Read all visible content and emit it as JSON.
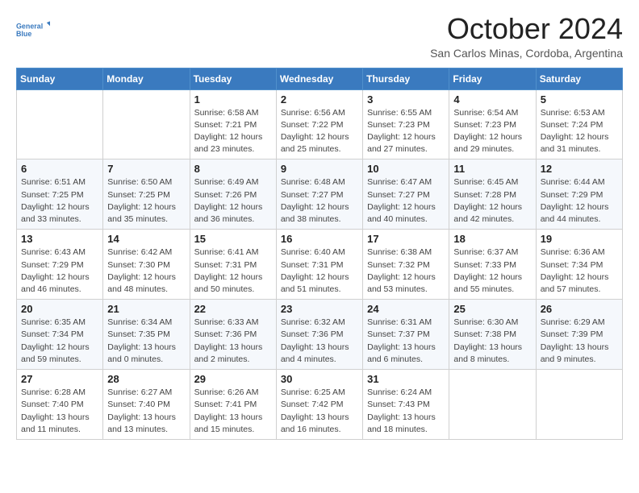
{
  "logo": {
    "line1": "General",
    "line2": "Blue"
  },
  "header": {
    "month": "October 2024",
    "location": "San Carlos Minas, Cordoba, Argentina"
  },
  "weekdays": [
    "Sunday",
    "Monday",
    "Tuesday",
    "Wednesday",
    "Thursday",
    "Friday",
    "Saturday"
  ],
  "weeks": [
    [
      {
        "day": "",
        "info": ""
      },
      {
        "day": "",
        "info": ""
      },
      {
        "day": "1",
        "info": "Sunrise: 6:58 AM\nSunset: 7:21 PM\nDaylight: 12 hours\nand 23 minutes."
      },
      {
        "day": "2",
        "info": "Sunrise: 6:56 AM\nSunset: 7:22 PM\nDaylight: 12 hours\nand 25 minutes."
      },
      {
        "day": "3",
        "info": "Sunrise: 6:55 AM\nSunset: 7:23 PM\nDaylight: 12 hours\nand 27 minutes."
      },
      {
        "day": "4",
        "info": "Sunrise: 6:54 AM\nSunset: 7:23 PM\nDaylight: 12 hours\nand 29 minutes."
      },
      {
        "day": "5",
        "info": "Sunrise: 6:53 AM\nSunset: 7:24 PM\nDaylight: 12 hours\nand 31 minutes."
      }
    ],
    [
      {
        "day": "6",
        "info": "Sunrise: 6:51 AM\nSunset: 7:25 PM\nDaylight: 12 hours\nand 33 minutes."
      },
      {
        "day": "7",
        "info": "Sunrise: 6:50 AM\nSunset: 7:25 PM\nDaylight: 12 hours\nand 35 minutes."
      },
      {
        "day": "8",
        "info": "Sunrise: 6:49 AM\nSunset: 7:26 PM\nDaylight: 12 hours\nand 36 minutes."
      },
      {
        "day": "9",
        "info": "Sunrise: 6:48 AM\nSunset: 7:27 PM\nDaylight: 12 hours\nand 38 minutes."
      },
      {
        "day": "10",
        "info": "Sunrise: 6:47 AM\nSunset: 7:27 PM\nDaylight: 12 hours\nand 40 minutes."
      },
      {
        "day": "11",
        "info": "Sunrise: 6:45 AM\nSunset: 7:28 PM\nDaylight: 12 hours\nand 42 minutes."
      },
      {
        "day": "12",
        "info": "Sunrise: 6:44 AM\nSunset: 7:29 PM\nDaylight: 12 hours\nand 44 minutes."
      }
    ],
    [
      {
        "day": "13",
        "info": "Sunrise: 6:43 AM\nSunset: 7:29 PM\nDaylight: 12 hours\nand 46 minutes."
      },
      {
        "day": "14",
        "info": "Sunrise: 6:42 AM\nSunset: 7:30 PM\nDaylight: 12 hours\nand 48 minutes."
      },
      {
        "day": "15",
        "info": "Sunrise: 6:41 AM\nSunset: 7:31 PM\nDaylight: 12 hours\nand 50 minutes."
      },
      {
        "day": "16",
        "info": "Sunrise: 6:40 AM\nSunset: 7:31 PM\nDaylight: 12 hours\nand 51 minutes."
      },
      {
        "day": "17",
        "info": "Sunrise: 6:38 AM\nSunset: 7:32 PM\nDaylight: 12 hours\nand 53 minutes."
      },
      {
        "day": "18",
        "info": "Sunrise: 6:37 AM\nSunset: 7:33 PM\nDaylight: 12 hours\nand 55 minutes."
      },
      {
        "day": "19",
        "info": "Sunrise: 6:36 AM\nSunset: 7:34 PM\nDaylight: 12 hours\nand 57 minutes."
      }
    ],
    [
      {
        "day": "20",
        "info": "Sunrise: 6:35 AM\nSunset: 7:34 PM\nDaylight: 12 hours\nand 59 minutes."
      },
      {
        "day": "21",
        "info": "Sunrise: 6:34 AM\nSunset: 7:35 PM\nDaylight: 13 hours\nand 0 minutes."
      },
      {
        "day": "22",
        "info": "Sunrise: 6:33 AM\nSunset: 7:36 PM\nDaylight: 13 hours\nand 2 minutes."
      },
      {
        "day": "23",
        "info": "Sunrise: 6:32 AM\nSunset: 7:36 PM\nDaylight: 13 hours\nand 4 minutes."
      },
      {
        "day": "24",
        "info": "Sunrise: 6:31 AM\nSunset: 7:37 PM\nDaylight: 13 hours\nand 6 minutes."
      },
      {
        "day": "25",
        "info": "Sunrise: 6:30 AM\nSunset: 7:38 PM\nDaylight: 13 hours\nand 8 minutes."
      },
      {
        "day": "26",
        "info": "Sunrise: 6:29 AM\nSunset: 7:39 PM\nDaylight: 13 hours\nand 9 minutes."
      }
    ],
    [
      {
        "day": "27",
        "info": "Sunrise: 6:28 AM\nSunset: 7:40 PM\nDaylight: 13 hours\nand 11 minutes."
      },
      {
        "day": "28",
        "info": "Sunrise: 6:27 AM\nSunset: 7:40 PM\nDaylight: 13 hours\nand 13 minutes."
      },
      {
        "day": "29",
        "info": "Sunrise: 6:26 AM\nSunset: 7:41 PM\nDaylight: 13 hours\nand 15 minutes."
      },
      {
        "day": "30",
        "info": "Sunrise: 6:25 AM\nSunset: 7:42 PM\nDaylight: 13 hours\nand 16 minutes."
      },
      {
        "day": "31",
        "info": "Sunrise: 6:24 AM\nSunset: 7:43 PM\nDaylight: 13 hours\nand 18 minutes."
      },
      {
        "day": "",
        "info": ""
      },
      {
        "day": "",
        "info": ""
      }
    ]
  ]
}
